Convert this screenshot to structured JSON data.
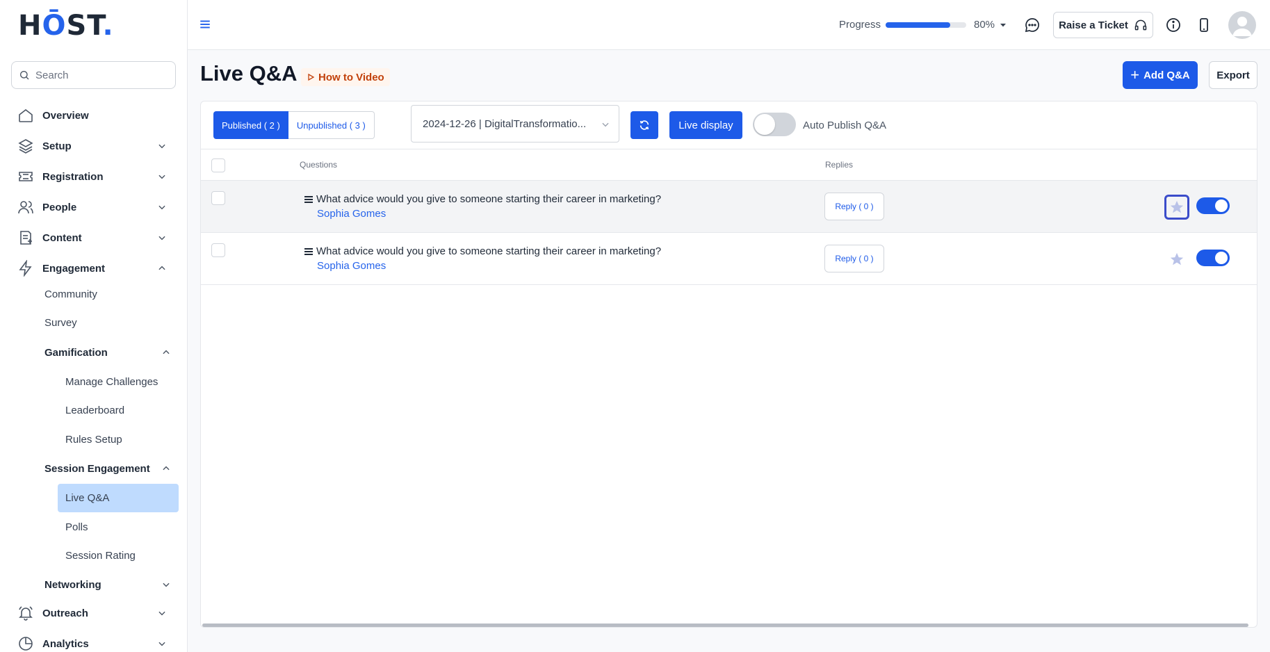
{
  "brand": {
    "logo_text": "HOST",
    "logo_dot": "."
  },
  "search": {
    "placeholder": "Search"
  },
  "sidebar": {
    "items": [
      {
        "label": "Overview",
        "icon": "home-icon"
      },
      {
        "label": "Setup",
        "icon": "layers-icon"
      },
      {
        "label": "Registration",
        "icon": "ticket-icon"
      },
      {
        "label": "People",
        "icon": "users-icon"
      },
      {
        "label": "Content",
        "icon": "document-icon"
      },
      {
        "label": "Engagement",
        "icon": "lightning-icon"
      },
      {
        "label": "Outreach",
        "icon": "bell-icon"
      },
      {
        "label": "Analytics",
        "icon": "pie-chart-icon"
      }
    ],
    "engagement_sub": {
      "community": "Community",
      "survey": "Survey",
      "gamification": "Gamification",
      "manage_challenges": "Manage Challenges",
      "leaderboard": "Leaderboard",
      "rules_setup": "Rules Setup",
      "session_engagement": "Session Engagement",
      "live_qa": "Live Q&A",
      "polls": "Polls",
      "session_rating": "Session Rating",
      "networking": "Networking"
    }
  },
  "header": {
    "progress_label": "Progress",
    "progress_value": 0.8,
    "progress_text": "80%",
    "ticket_label": "Raise a Ticket"
  },
  "page": {
    "title": "Live Q&A",
    "how_to": "How to Video",
    "add_label": "Add Q&A",
    "export_label": "Export"
  },
  "toolbar": {
    "published_tab": "Published ( 2 )",
    "unpublished_tab": "Unpublished ( 3 )",
    "session_value": "2024-12-26 | DigitalTransformatio...",
    "live_display": "Live display",
    "auto_publish": "Auto Publish Q&A",
    "auto_publish_on": false
  },
  "table": {
    "columns": {
      "questions": "Questions",
      "replies": "Replies"
    },
    "rows": [
      {
        "question": "What advice would you give to someone starting their career in marketing?",
        "author": "Sophia Gomes",
        "reply": "Reply ( 0 )",
        "published": true
      },
      {
        "question": "What advice would you give to someone starting their career in marketing?",
        "author": "Sophia Gomes",
        "reply": "Reply ( 0 )",
        "published": true
      }
    ]
  },
  "colors": {
    "accent": "#1d5ae8",
    "active_nav": "#bfdbfe",
    "how_to": "#c2410c"
  }
}
